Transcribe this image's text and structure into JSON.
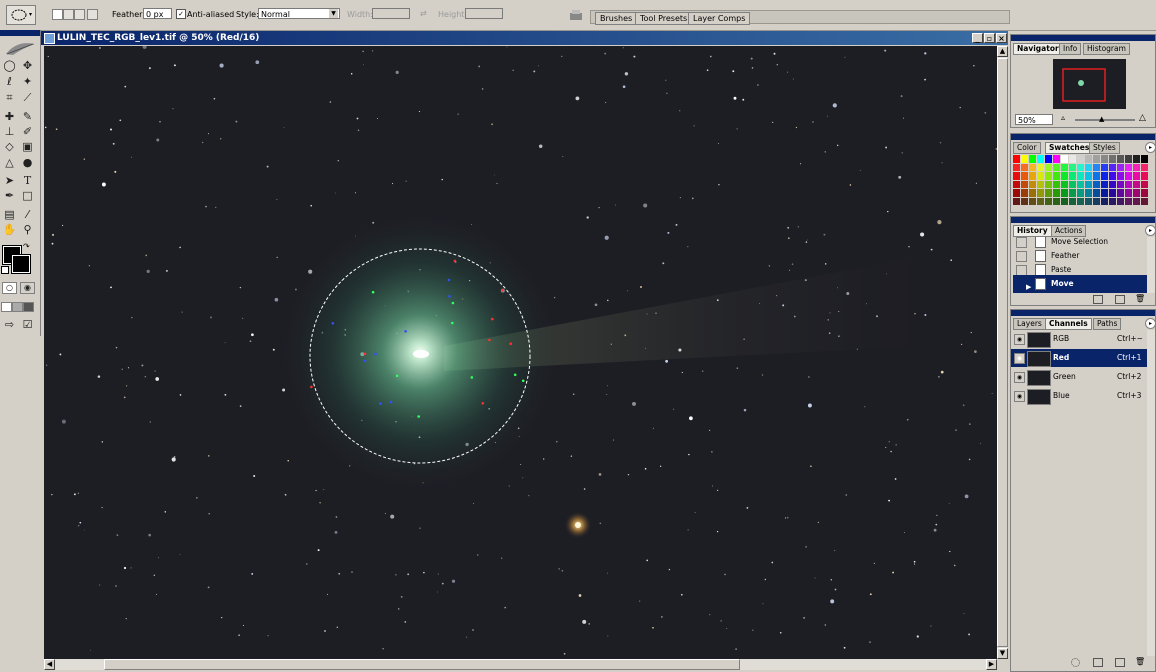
{
  "options_bar": {
    "feather_label": "Feather:",
    "feather_value": "0 px",
    "antialiased_check": "✓",
    "antialiased_label": "Anti-aliased",
    "style_label": "Style:",
    "style_value": "Normal",
    "width_label": "Width:",
    "height_label": "Height:",
    "well_tabs": [
      "Brushes",
      "Tool Presets",
      "Layer Comps"
    ]
  },
  "document": {
    "title": "LULIN_TEC_RGB_lev1.tif @ 50% (Red/16)"
  },
  "navigator": {
    "tabs": [
      "Navigator",
      "Info",
      "Histogram"
    ],
    "zoom": "50%"
  },
  "swatches_panel": {
    "tabs": [
      "Color",
      "Swatches",
      "Styles"
    ]
  },
  "history": {
    "tabs": [
      "History",
      "Actions"
    ],
    "items": [
      {
        "label": "Move Selection",
        "selected": false
      },
      {
        "label": "Feather",
        "selected": false
      },
      {
        "label": "Paste",
        "selected": false
      },
      {
        "label": "Move",
        "selected": true
      }
    ]
  },
  "channels": {
    "tabs": [
      "Layers",
      "Channels",
      "Paths"
    ],
    "items": [
      {
        "name": "RGB",
        "shortcut": "Ctrl+~",
        "selected": false
      },
      {
        "name": "Red",
        "shortcut": "Ctrl+1",
        "selected": true
      },
      {
        "name": "Green",
        "shortcut": "Ctrl+2",
        "selected": false
      },
      {
        "name": "Blue",
        "shortcut": "Ctrl+3",
        "selected": false
      }
    ]
  },
  "colors": {
    "title_bar": "#0a246a",
    "canvas_bg": "#1d1d24",
    "selection_blue": "#0a246a",
    "comet_green": "#7fd8a8"
  }
}
